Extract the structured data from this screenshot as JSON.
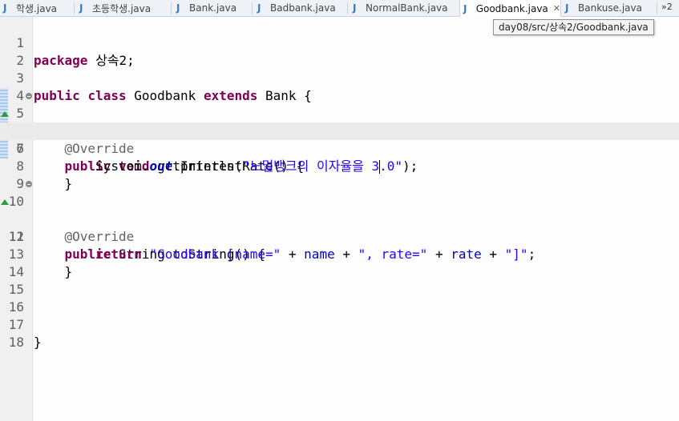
{
  "tabs": [
    {
      "label": "학생.java",
      "active": false
    },
    {
      "label": "초등학생.java",
      "active": false
    },
    {
      "label": "Bank.java",
      "active": false
    },
    {
      "label": "Badbank.java",
      "active": false
    },
    {
      "label": "NormalBank.java",
      "active": false
    },
    {
      "label": "Goodbank.java",
      "active": true
    },
    {
      "label": "Bankuse.java",
      "active": false
    }
  ],
  "tab_icon_letter": "J",
  "overflow_label": "»2",
  "tooltip": "day08/src/상속2/Goodbank.java",
  "line_numbers": [
    "1",
    "2",
    "3",
    "4",
    "5",
    "6",
    "7",
    "8",
    "9",
    "10",
    "11",
    "12",
    "13",
    "14",
    "15",
    "16",
    "17",
    "18"
  ],
  "code": {
    "l1": {
      "kw": "package",
      "rest": " 상속2;"
    },
    "l3": {
      "kw1": "public",
      "kw2": "class",
      "name": " Goodbank ",
      "kw3": "extends",
      "rest": " Bank {"
    },
    "l5": {
      "ann": "@Override"
    },
    "l6": {
      "kw1": "public",
      "kw2": "void",
      "rest": " getInterestRate() {"
    },
    "l7": {
      "pre": "System.",
      "field": "out",
      "mid": ".println(",
      "str_a": "\"노멀뱅크의 이자율을 3",
      "str_b": ".0\"",
      "post": ");"
    },
    "l8": {
      "text": "}"
    },
    "l10": {
      "ann": "@Override"
    },
    "l11": {
      "kw1": "public",
      "rest": " String toString() {"
    },
    "l12": {
      "kw": "return",
      "s1": "\"Goodbank [name=\"",
      "p1": " + ",
      "f1": "name",
      "p2": " + ",
      "s2": "\", rate=\"",
      "p3": " + ",
      "f2": "rate",
      "p4": " + ",
      "s3": "\"]\"",
      "end": ";"
    },
    "l13": {
      "text": "}"
    },
    "l17": {
      "text": "}"
    }
  }
}
